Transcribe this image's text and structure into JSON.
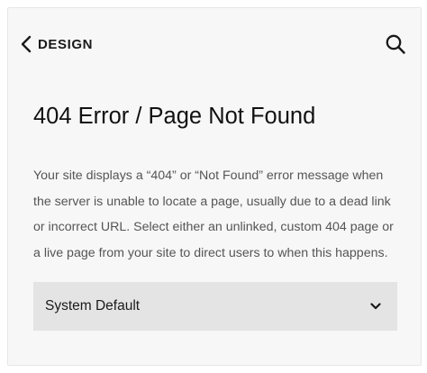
{
  "header": {
    "back_label": "DESIGN"
  },
  "page": {
    "title": "404 Error / Page Not Found",
    "description": "Your site displays a “404” or “Not Found” error message when the server is unable to locate a page, usually due to a dead link or incorrect URL. Select either an unlinked, custom 404 page or a live page from your site to direct users to when this happens."
  },
  "select": {
    "value": "System Default"
  },
  "icons": {
    "back": "chevron-left-icon",
    "search": "search-icon",
    "dropdown": "chevron-down-icon"
  },
  "colors": {
    "panel_background": "#f7f7f7",
    "select_background": "#e4e4e4",
    "title": "#111111",
    "body_text": "#555555"
  }
}
